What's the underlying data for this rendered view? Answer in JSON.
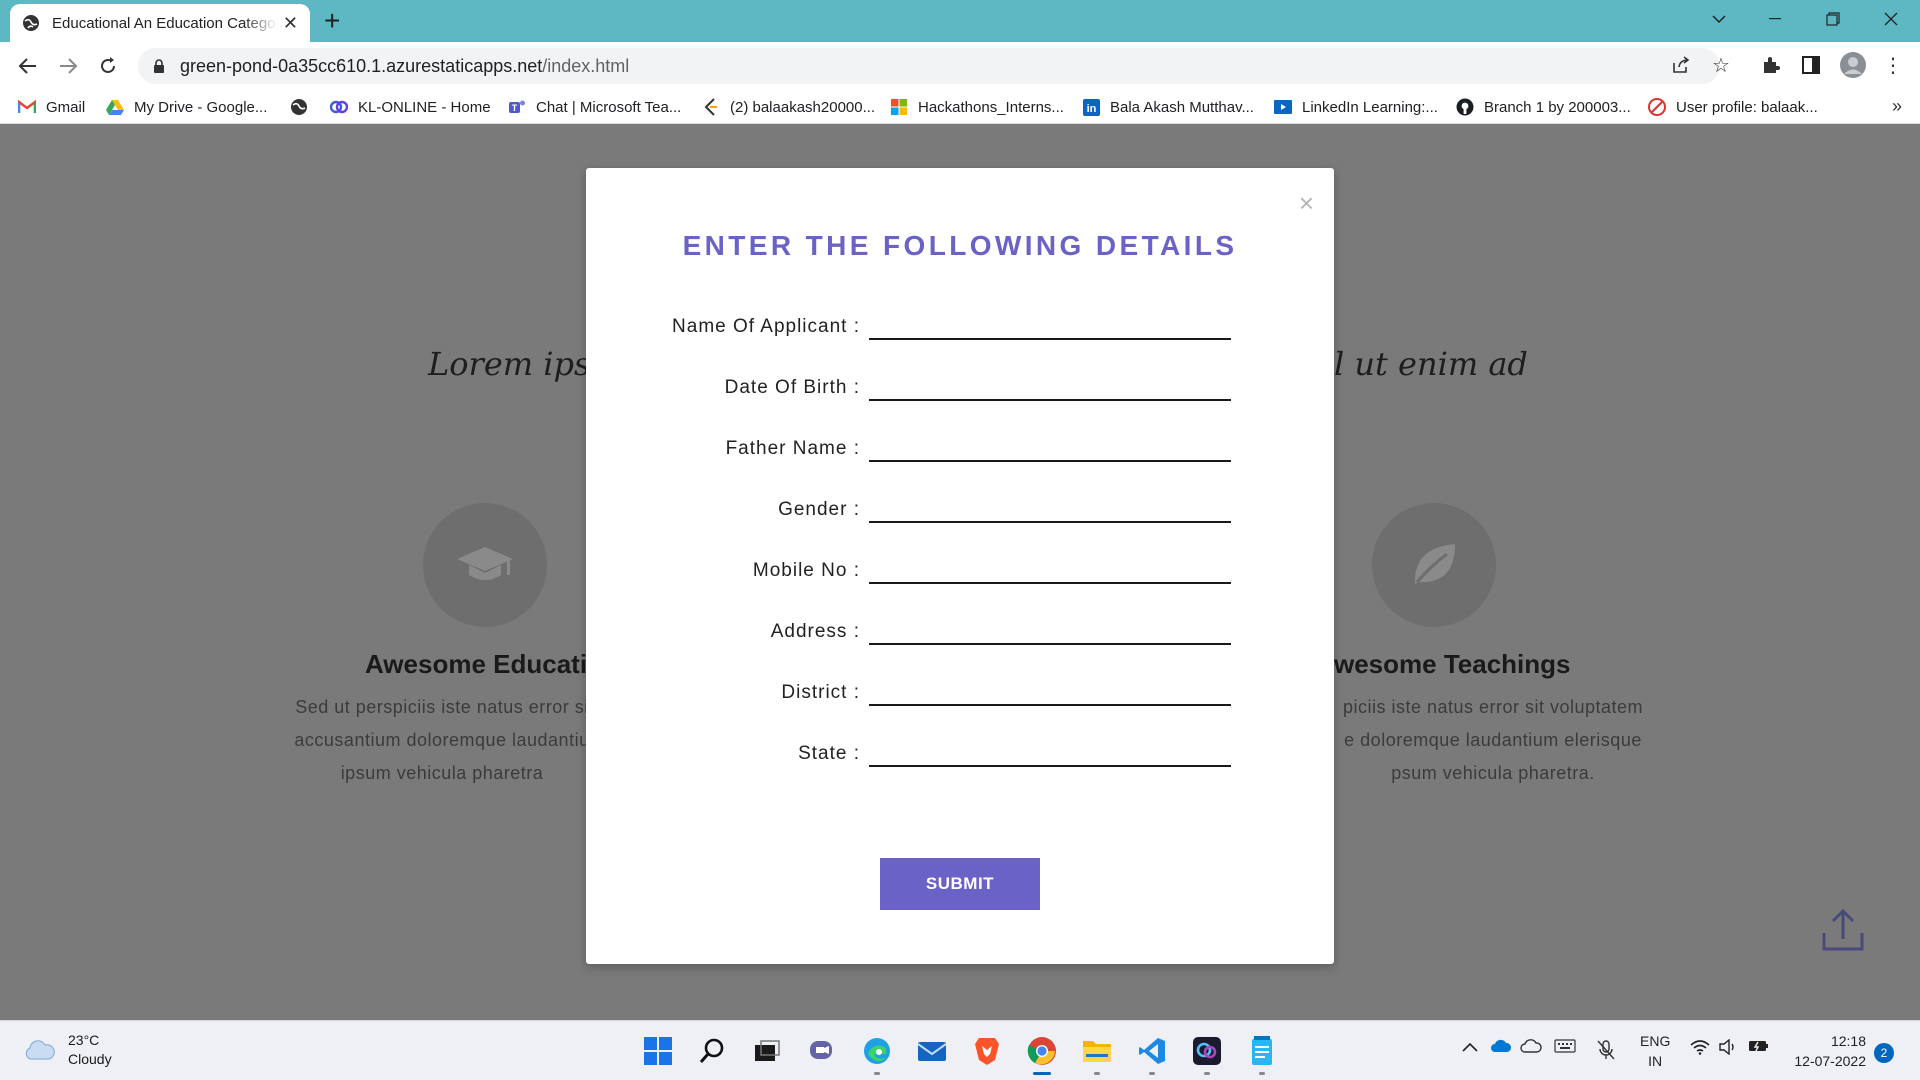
{
  "browser": {
    "tab_title": "Educational An Education Catego",
    "tab_close": "✕",
    "new_tab": "+",
    "url_host": "green-pond-0a35cc610.1.azurestaticapps.net",
    "url_path": "/index.html",
    "window_controls": [
      "minimize",
      "restore",
      "close"
    ],
    "bookmarks": [
      {
        "label": "Gmail",
        "icon": "gmail-icon"
      },
      {
        "label": "My Drive - Google...",
        "icon": "google-drive-icon"
      },
      {
        "label": "",
        "icon": "globe-icon"
      },
      {
        "label": "KL-ONLINE - Home",
        "icon": "kl-online-icon"
      },
      {
        "label": "Chat | Microsoft Tea...",
        "icon": "teams-icon"
      },
      {
        "label": "(2) balaakash20000...",
        "icon": "leetcode-icon"
      },
      {
        "label": "Hackathons_Interns...",
        "icon": "microsoft-icon"
      },
      {
        "label": "Bala Akash Mutthav...",
        "icon": "linkedin-icon"
      },
      {
        "label": "LinkedIn Learning:...",
        "icon": "linkedin-learning-icon"
      },
      {
        "label": "Branch 1 by 200003...",
        "icon": "github-icon"
      },
      {
        "label": "User profile: balaak...",
        "icon": "profile-icon"
      }
    ],
    "bookmarks_more": "»"
  },
  "page": {
    "script_left": "Lorem ipsum",
    "script_right": "l ut enim ad",
    "feature_left": {
      "title": "Awesome Educatio",
      "lines": [
        "Sed ut perspiciis iste natus error si",
        "accusantium doloremque laudantiu",
        "ipsum vehicula pharetra"
      ]
    },
    "feature_right": {
      "title": "wesome Teachings",
      "lines": [
        "piciis iste natus error sit voluptatem",
        "e doloremque laudantium elerisque",
        "psum vehicula pharetra."
      ]
    }
  },
  "modal": {
    "close": "×",
    "title": "ENTER THE FOLLOWING DETAILS",
    "fields": [
      {
        "label": "Name Of Applicant :",
        "value": ""
      },
      {
        "label": "Date Of Birth :",
        "value": ""
      },
      {
        "label": "Father Name :",
        "value": ""
      },
      {
        "label": "Gender :",
        "value": ""
      },
      {
        "label": "Mobile No :",
        "value": ""
      },
      {
        "label": "Address :",
        "value": ""
      },
      {
        "label": "District :",
        "value": ""
      },
      {
        "label": "State :",
        "value": ""
      }
    ],
    "submit_label": "SUBMIT",
    "accent_color": "#6a62c7"
  },
  "taskbar": {
    "weather_temp": "23°C",
    "weather_desc": "Cloudy",
    "lang_top": "ENG",
    "lang_bottom": "IN",
    "time": "12:18",
    "date": "12-07-2022",
    "notification_count": "2"
  }
}
